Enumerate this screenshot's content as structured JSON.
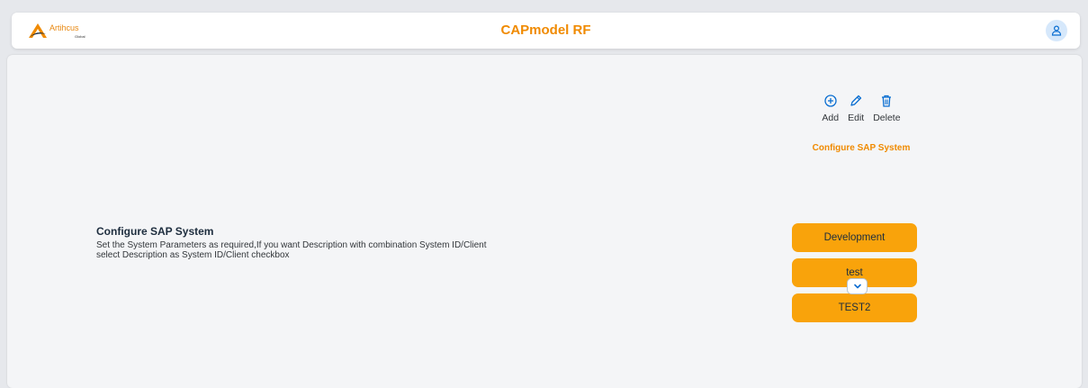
{
  "header": {
    "logo_text": "Artihcus",
    "logo_sub": "Global",
    "app_title": "CAPmodel RF"
  },
  "main": {
    "description": {
      "title": "Configure SAP System",
      "text_line1": "Set the System Parameters as required,If you want Description with combination System ID/Client",
      "text_line2": "select Description as System ID/Client checkbox"
    },
    "actions": [
      {
        "label": "Add",
        "icon": "add-circle-icon"
      },
      {
        "label": "Edit",
        "icon": "pencil-icon"
      },
      {
        "label": "Delete",
        "icon": "trash-icon"
      }
    ],
    "section_label": "Configure SAP System",
    "systems": [
      "Development",
      "test",
      "TEST2"
    ]
  },
  "colors": {
    "accent": "#f08a00",
    "button": "#f9a30b",
    "icon_blue": "#0a6ed1"
  }
}
